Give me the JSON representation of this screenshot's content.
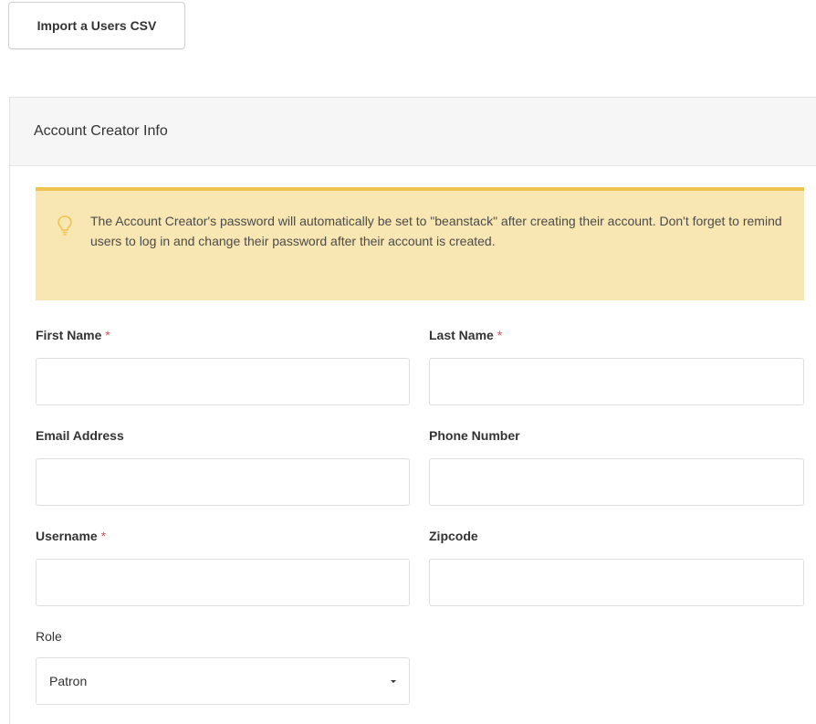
{
  "toolbar": {
    "import_label": "Import a Users CSV"
  },
  "panel": {
    "title": "Account Creator Info"
  },
  "alert": {
    "icon": "lightbulb-icon",
    "text": "The Account Creator's password will automatically be set to \"beanstack\" after creating their account. Don't forget to remind users to log in and change their password after their account is created."
  },
  "form": {
    "first_name": {
      "label": "First Name",
      "required_mark": "*",
      "value": ""
    },
    "last_name": {
      "label": "Last Name",
      "required_mark": "*",
      "value": ""
    },
    "email": {
      "label": "Email Address",
      "value": ""
    },
    "phone": {
      "label": "Phone Number",
      "value": ""
    },
    "username": {
      "label": "Username",
      "required_mark": "*",
      "value": ""
    },
    "zipcode": {
      "label": "Zipcode",
      "value": ""
    },
    "role": {
      "label": "Role",
      "selected": "Patron"
    }
  },
  "colors": {
    "alert_bg": "#f9e7b3",
    "alert_border": "#f0c350",
    "required": "#d9534f"
  }
}
